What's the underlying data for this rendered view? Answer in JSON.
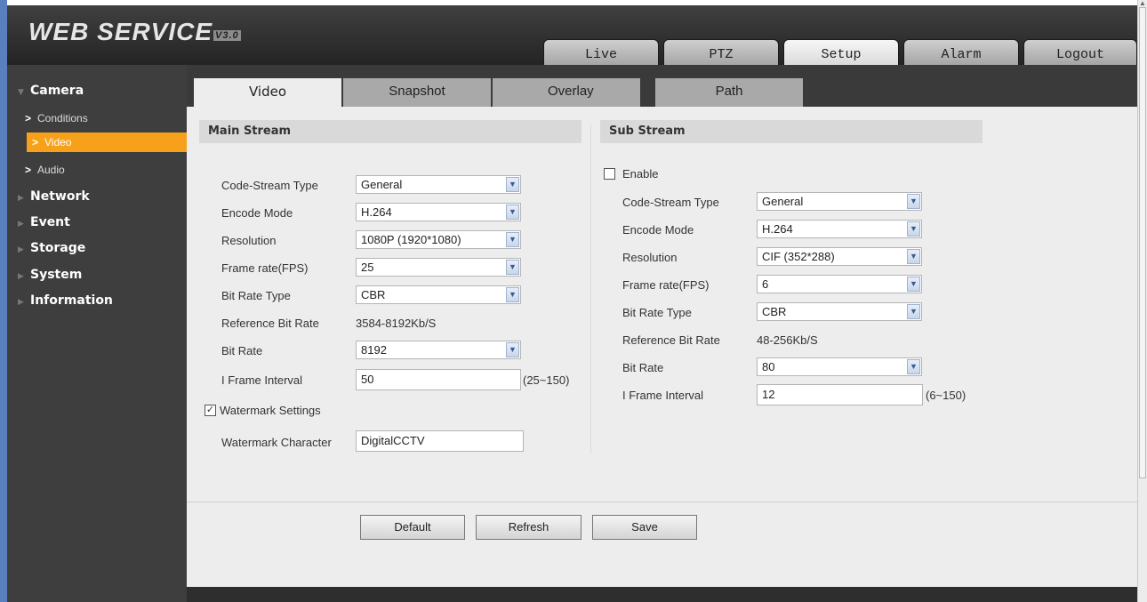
{
  "header": {
    "logo": "WEB SERVICE",
    "version": "V3.0",
    "tabs": [
      {
        "label": "Live",
        "active": false
      },
      {
        "label": "PTZ",
        "active": false
      },
      {
        "label": "Setup",
        "active": true
      },
      {
        "label": "Alarm",
        "active": false
      },
      {
        "label": "Logout",
        "active": false
      }
    ]
  },
  "sidebar": {
    "camera": "Camera",
    "camera_items": [
      "Conditions",
      "Video",
      "Audio"
    ],
    "active_item": "Video",
    "sections": [
      "Network",
      "Event",
      "Storage",
      "System",
      "Information"
    ]
  },
  "subtabs": [
    {
      "label": "Video",
      "active": true
    },
    {
      "label": "Snapshot",
      "active": false
    },
    {
      "label": "Overlay",
      "active": false
    },
    {
      "label": "Path",
      "active": false
    }
  ],
  "main_stream": {
    "title": "Main Stream",
    "code_stream_type_label": "Code-Stream Type",
    "code_stream_type": "General",
    "encode_mode_label": "Encode Mode",
    "encode_mode": "H.264",
    "resolution_label": "Resolution",
    "resolution": "1080P (1920*1080)",
    "frame_rate_label": "Frame rate(FPS)",
    "frame_rate": "25",
    "bit_rate_type_label": "Bit Rate Type",
    "bit_rate_type": "CBR",
    "reference_bit_rate_label": "Reference Bit Rate",
    "reference_bit_rate": "3584-8192Kb/S",
    "bit_rate_label": "Bit Rate",
    "bit_rate": "8192",
    "i_frame_interval_label": "I Frame Interval",
    "i_frame_interval": "50",
    "i_frame_range": "(25~150)",
    "watermark_label": "Watermark Settings",
    "watermark_checked": true,
    "watermark_char_label": "Watermark Character",
    "watermark_char": "DigitalCCTV"
  },
  "sub_stream": {
    "title": "Sub Stream",
    "enable_label": "Enable",
    "enable_checked": false,
    "code_stream_type_label": "Code-Stream Type",
    "code_stream_type": "General",
    "encode_mode_label": "Encode Mode",
    "encode_mode": "H.264",
    "resolution_label": "Resolution",
    "resolution": "CIF (352*288)",
    "frame_rate_label": "Frame rate(FPS)",
    "frame_rate": "6",
    "bit_rate_type_label": "Bit Rate Type",
    "bit_rate_type": "CBR",
    "reference_bit_rate_label": "Reference Bit Rate",
    "reference_bit_rate": "48-256Kb/S",
    "bit_rate_label": "Bit Rate",
    "bit_rate": "80",
    "i_frame_interval_label": "I Frame Interval",
    "i_frame_interval": "12",
    "i_frame_range": "(6~150)"
  },
  "buttons": {
    "default": "Default",
    "refresh": "Refresh",
    "save": "Save"
  },
  "icons": {
    "dropdown": "chevron-down-icon",
    "checkbox": "check-icon",
    "sidebar_expand": "triangle-right-icon",
    "sidebar_collapse": "triangle-down-icon"
  },
  "colors": {
    "accent": "#f7a11a",
    "header": "#2f2f2f",
    "panel": "#ededed"
  }
}
